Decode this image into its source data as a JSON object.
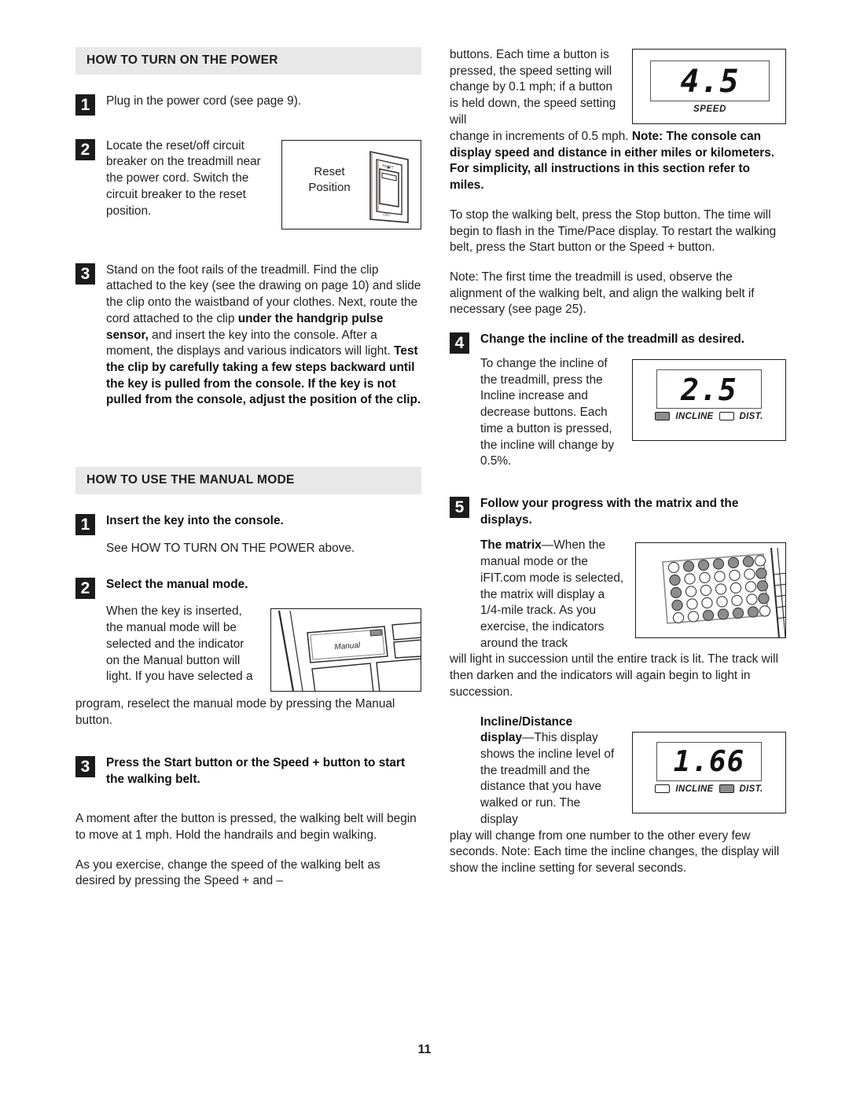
{
  "page": {
    "number": "11"
  },
  "left_column": {
    "section1": {
      "heading": "HOW TO TURN ON THE POWER",
      "steps": [
        {
          "num": "1",
          "text": "Plug in the power cord (see page 9)."
        },
        {
          "num": "2",
          "text": "Locate the reset/off circuit breaker on the treadmill near the power cord. Switch the circuit breaker to the reset position."
        },
        {
          "num": "3",
          "part1": "Stand on the foot rails of the treadmill. Find the clip attached to the key (see the drawing on page 10) and slide the clip onto the waistband of your clothes. Next, route the cord attached to the clip ",
          "bold1": "under the handgrip pulse sensor,",
          "part2": " and insert the key into the console. After a moment, the displays and various indicators will light. ",
          "bold2": "Test the clip by carefully taking a few steps backward until the key is pulled from the console. If the key is not pulled from the console, adjust the position of the clip."
        }
      ],
      "reset_figure": {
        "label_line1": "Reset",
        "label_line2": "Position",
        "switch_top_label": "RESET",
        "switch_bottom_label": "OFF"
      }
    },
    "section2": {
      "heading": "HOW TO USE THE MANUAL MODE",
      "steps": [
        {
          "num": "1",
          "bold_title": "Insert the key into the console.",
          "body": "See HOW TO TURN ON THE POWER above."
        },
        {
          "num": "2",
          "bold_title": "Select the manual mode.",
          "body_wrapped": "When the key is inserted, the manual mode will be selected and the indicator on the Manual button will light. If you have selected a",
          "body_full": "program, reselect the manual mode by pressing the Manual button.",
          "figure_button_label": "Manual"
        },
        {
          "num": "3",
          "bold_title": "Press the Start button or the Speed + button to start the walking belt.",
          "para1": "A moment after the button is pressed, the walking belt will begin to move at 1 mph. Hold the handrails and begin walking.",
          "para2": "As you exercise, change the speed of the walking belt as desired by pressing the Speed + and –"
        }
      ]
    }
  },
  "right_column": {
    "continued_wrapped": "buttons. Each time a button is pressed, the speed setting will change by 0.1 mph; if a button is held down, the speed setting will",
    "continued_full_pre": "change in increments of 0.5 mph. ",
    "continued_full_bold": "Note: The console can display speed and distance in either miles or kilometers. For simplicity, all instructions in this section refer to miles.",
    "speed_figure": {
      "value": "4.5",
      "caption": "SPEED"
    },
    "para_stop": "To stop the walking belt, press the Stop button. The time will begin to flash in the Time/Pace display. To restart the walking belt, press the Start button or the Speed + button.",
    "para_note": "Note: The first time the treadmill is used, observe the alignment of the walking belt, and align the walking belt if necessary (see page 25).",
    "steps": [
      {
        "num": "4",
        "bold_title": "Change the incline of the treadmill as desired.",
        "body": "To change the incline of the treadmill, press the Incline increase and decrease buttons. Each time a button is pressed, the incline will change by 0.5%.",
        "figure": {
          "value": "2.5",
          "label_incline": "INCLINE",
          "label_dist": "DIST.",
          "incline_on": true,
          "dist_on": false
        }
      },
      {
        "num": "5",
        "bold_title": "Follow your progress with the matrix and the displays.",
        "matrix_bold": "The matrix",
        "matrix_body_wrapped": "—When the manual mode or the iFIT.com mode is selected, the matrix will display a 1/4-mile track. As you exercise, the indicators around the track",
        "matrix_body_full": "will light in succession until the entire track is lit. The track will then darken and the indicators will again begin to light in succession.",
        "incdist_bold_line1": "Incline/Distance",
        "incdist_bold_line2": "display",
        "incdist_body_wrapped": "—This display shows the incline level of the treadmill and the distance that you have walked or run. The display",
        "incdist_body_full": "play will change from one number to the other every few seconds. Note: Each time the incline changes, the display will show the incline setting for several seconds.",
        "figure": {
          "value": "1.66",
          "label_incline": "INCLINE",
          "label_dist": "DIST.",
          "incline_on": false,
          "dist_on": true
        }
      }
    ]
  },
  "colors": {
    "heading_band": "#e8e8e8",
    "step_badge": "#1c1c1c",
    "text": "#1f1f1f",
    "led_on": "#8d8d8d",
    "matrix_dot_on": "#8d8d8d"
  }
}
